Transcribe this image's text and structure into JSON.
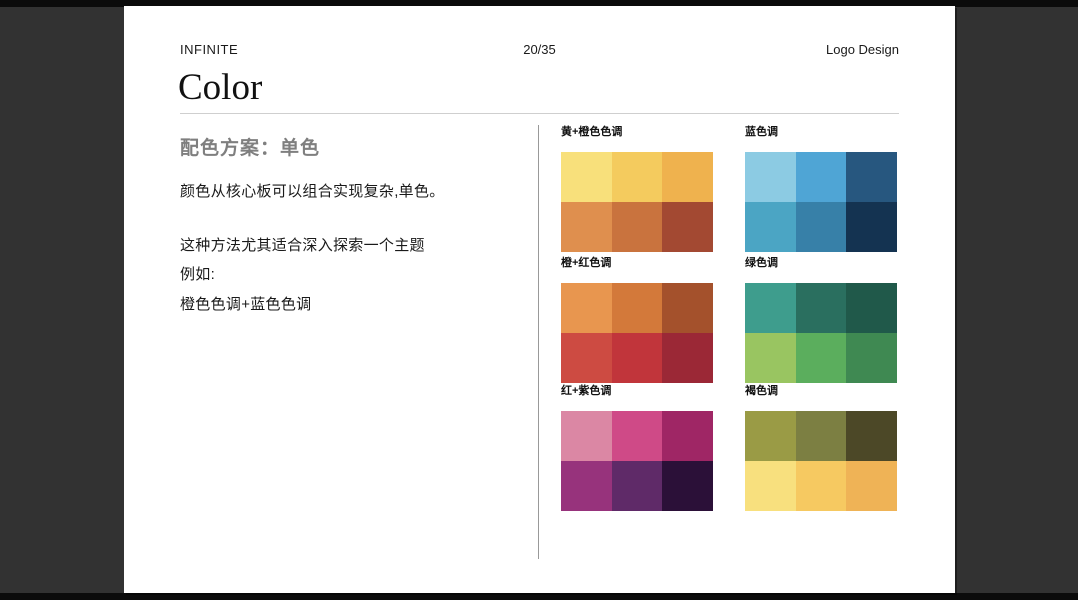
{
  "window": {
    "outer_background": "#323232",
    "edge_bar_color": "#0b0b0b",
    "slide_background": "#ffffff"
  },
  "header": {
    "brand": "INFINITE",
    "page_indicator": "20/35",
    "section": "Logo Design"
  },
  "title": "Color",
  "left_panel": {
    "heading": "配色方案：单色",
    "heading_color": "#7f7f7f",
    "lines": [
      "颜色从核心板可以组合实现复杂,单色。",
      "这种方法尤其适合深入探索一个主题",
      "例如:",
      "橙色色调+蓝色色调"
    ]
  },
  "palettes": [
    {
      "label": "黄+橙色色调",
      "colors": [
        "#F8E07B",
        "#F4CB5E",
        "#EFB24E",
        "#DF8F4E",
        "#C9733E",
        "#A34932"
      ]
    },
    {
      "label": "蓝色调",
      "colors": [
        "#8CCBE3",
        "#4FA5D5",
        "#27577F",
        "#4BA5C4",
        "#3780A8",
        "#143351"
      ]
    },
    {
      "label": "橙+红色调",
      "colors": [
        "#E8964F",
        "#D3793A",
        "#A4512C",
        "#CD4B42",
        "#C1353B",
        "#9B2836"
      ]
    },
    {
      "label": "绿色调",
      "colors": [
        "#3E9D8D",
        "#2A6F5F",
        "#20594A",
        "#99C561",
        "#5BAE5D",
        "#3F8952"
      ]
    },
    {
      "label": "红+紫色调",
      "colors": [
        "#DB87A4",
        "#CF4A87",
        "#9F2665",
        "#97337C",
        "#5F2A68",
        "#2B1038"
      ]
    },
    {
      "label": "褐色调",
      "colors": [
        "#9A9B45",
        "#7C7F42",
        "#4C4827",
        "#F8E07E",
        "#F6C961",
        "#EFB356"
      ]
    }
  ]
}
